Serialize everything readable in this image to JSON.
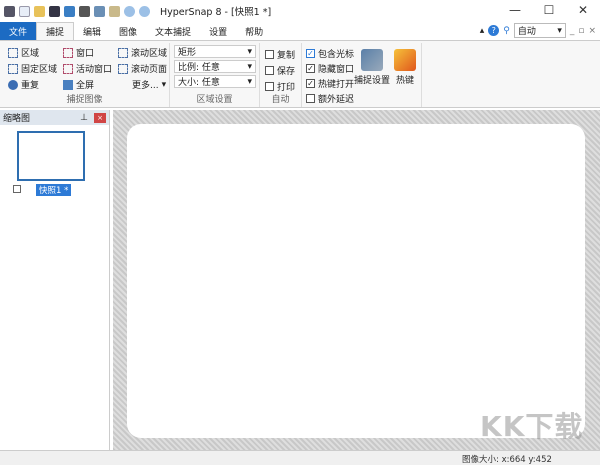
{
  "window": {
    "title": "HyperSnap 8 - [快照1 *]",
    "minimize": "—",
    "maximize": "☐",
    "close": "✕"
  },
  "tabs": [
    "文件",
    "捕捉",
    "编辑",
    "图像",
    "文本捕捉",
    "设置",
    "帮助"
  ],
  "right_tools": {
    "zoom_value": "自动",
    "help": "?"
  },
  "ribbon": {
    "capture_image": {
      "label": "捕捉图像",
      "items": [
        "区域",
        "固定区域",
        "重复",
        "窗口",
        "活动窗口",
        "全屏",
        "滚动区域",
        "滚动页面",
        "更多..."
      ]
    },
    "region_settings": {
      "label": "区域设置",
      "shape": "矩形",
      "ratio": "比例: 任意",
      "size": "大小: 任意"
    },
    "auto": {
      "label": "自动",
      "items": [
        {
          "label": "复制",
          "checked": false
        },
        {
          "label": "保存",
          "checked": false
        },
        {
          "label": "打印",
          "checked": false
        }
      ]
    },
    "options": {
      "items": [
        {
          "label": "包含光标",
          "checked": true
        },
        {
          "label": "隐藏窗口",
          "checked": true
        },
        {
          "label": "热键打开",
          "checked": true
        },
        {
          "label": "额外延迟",
          "checked": false
        }
      ]
    },
    "capture_settings": "捕捉设置",
    "hotkeys": "热键"
  },
  "sidebar": {
    "title": "缩略图",
    "thumb_label": "快照1 *"
  },
  "status": {
    "image_size": "图像大小: x:664 y:452"
  },
  "watermark": "KK下载"
}
